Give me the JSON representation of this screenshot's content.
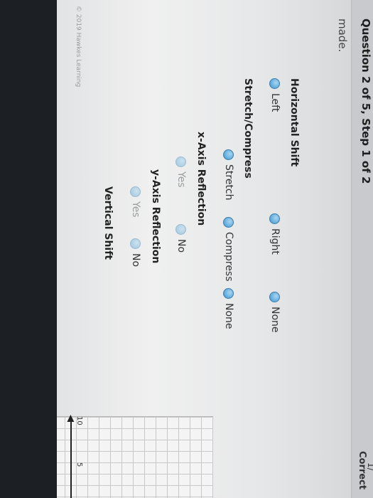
{
  "header": {
    "question_title": "Question 2 of 5, Step 1 of 2",
    "score_fraction": "1/",
    "correct_label": "Correct",
    "prompt_tail": "made."
  },
  "sections": {
    "horizontal_shift": {
      "label": "Horizontal Shift",
      "options": [
        "Left",
        "Right",
        "None"
      ]
    },
    "stretch_compress": {
      "label": "Stretch/Compress",
      "options": [
        "Stretch",
        "Compress",
        "None"
      ]
    },
    "x_axis_reflection": {
      "label": "x-Axis Reflection",
      "options": [
        "Yes",
        "No"
      ]
    },
    "y_axis_reflection": {
      "label": "y-Axis Reflection",
      "options": [
        "Yes",
        "No"
      ]
    },
    "vertical_shift": {
      "label": "Vertical Shift"
    }
  },
  "graph": {
    "tick_labels": [
      "10",
      "5"
    ]
  },
  "footer": {
    "copyright": "© 2019 Hawkes Learning"
  },
  "colors": {
    "radio_fill": "#6db3e0",
    "radio_border": "#3a7cae",
    "page_background": "#ececec"
  }
}
